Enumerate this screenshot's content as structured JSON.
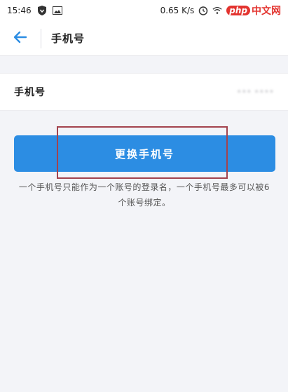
{
  "status_bar": {
    "time": "15:46",
    "speed": "0.65 K/s",
    "watermark_php": "php",
    "watermark_cn": "中文网",
    "icons": [
      "shield-icon",
      "image-icon",
      "alarm-icon",
      "wifi-icon"
    ]
  },
  "app_bar": {
    "title": "手机号"
  },
  "phone": {
    "label": "手机号",
    "value": "••• ••••"
  },
  "change_button": {
    "label": "更换手机号"
  },
  "note": {
    "text": "一个手机号只能作为一个账号的登录名，一个手机号最多可以被6个账号绑定。"
  },
  "colors": {
    "accent": "#2c8de3",
    "background": "#f3f4f8",
    "highlight": "#a3434e"
  }
}
